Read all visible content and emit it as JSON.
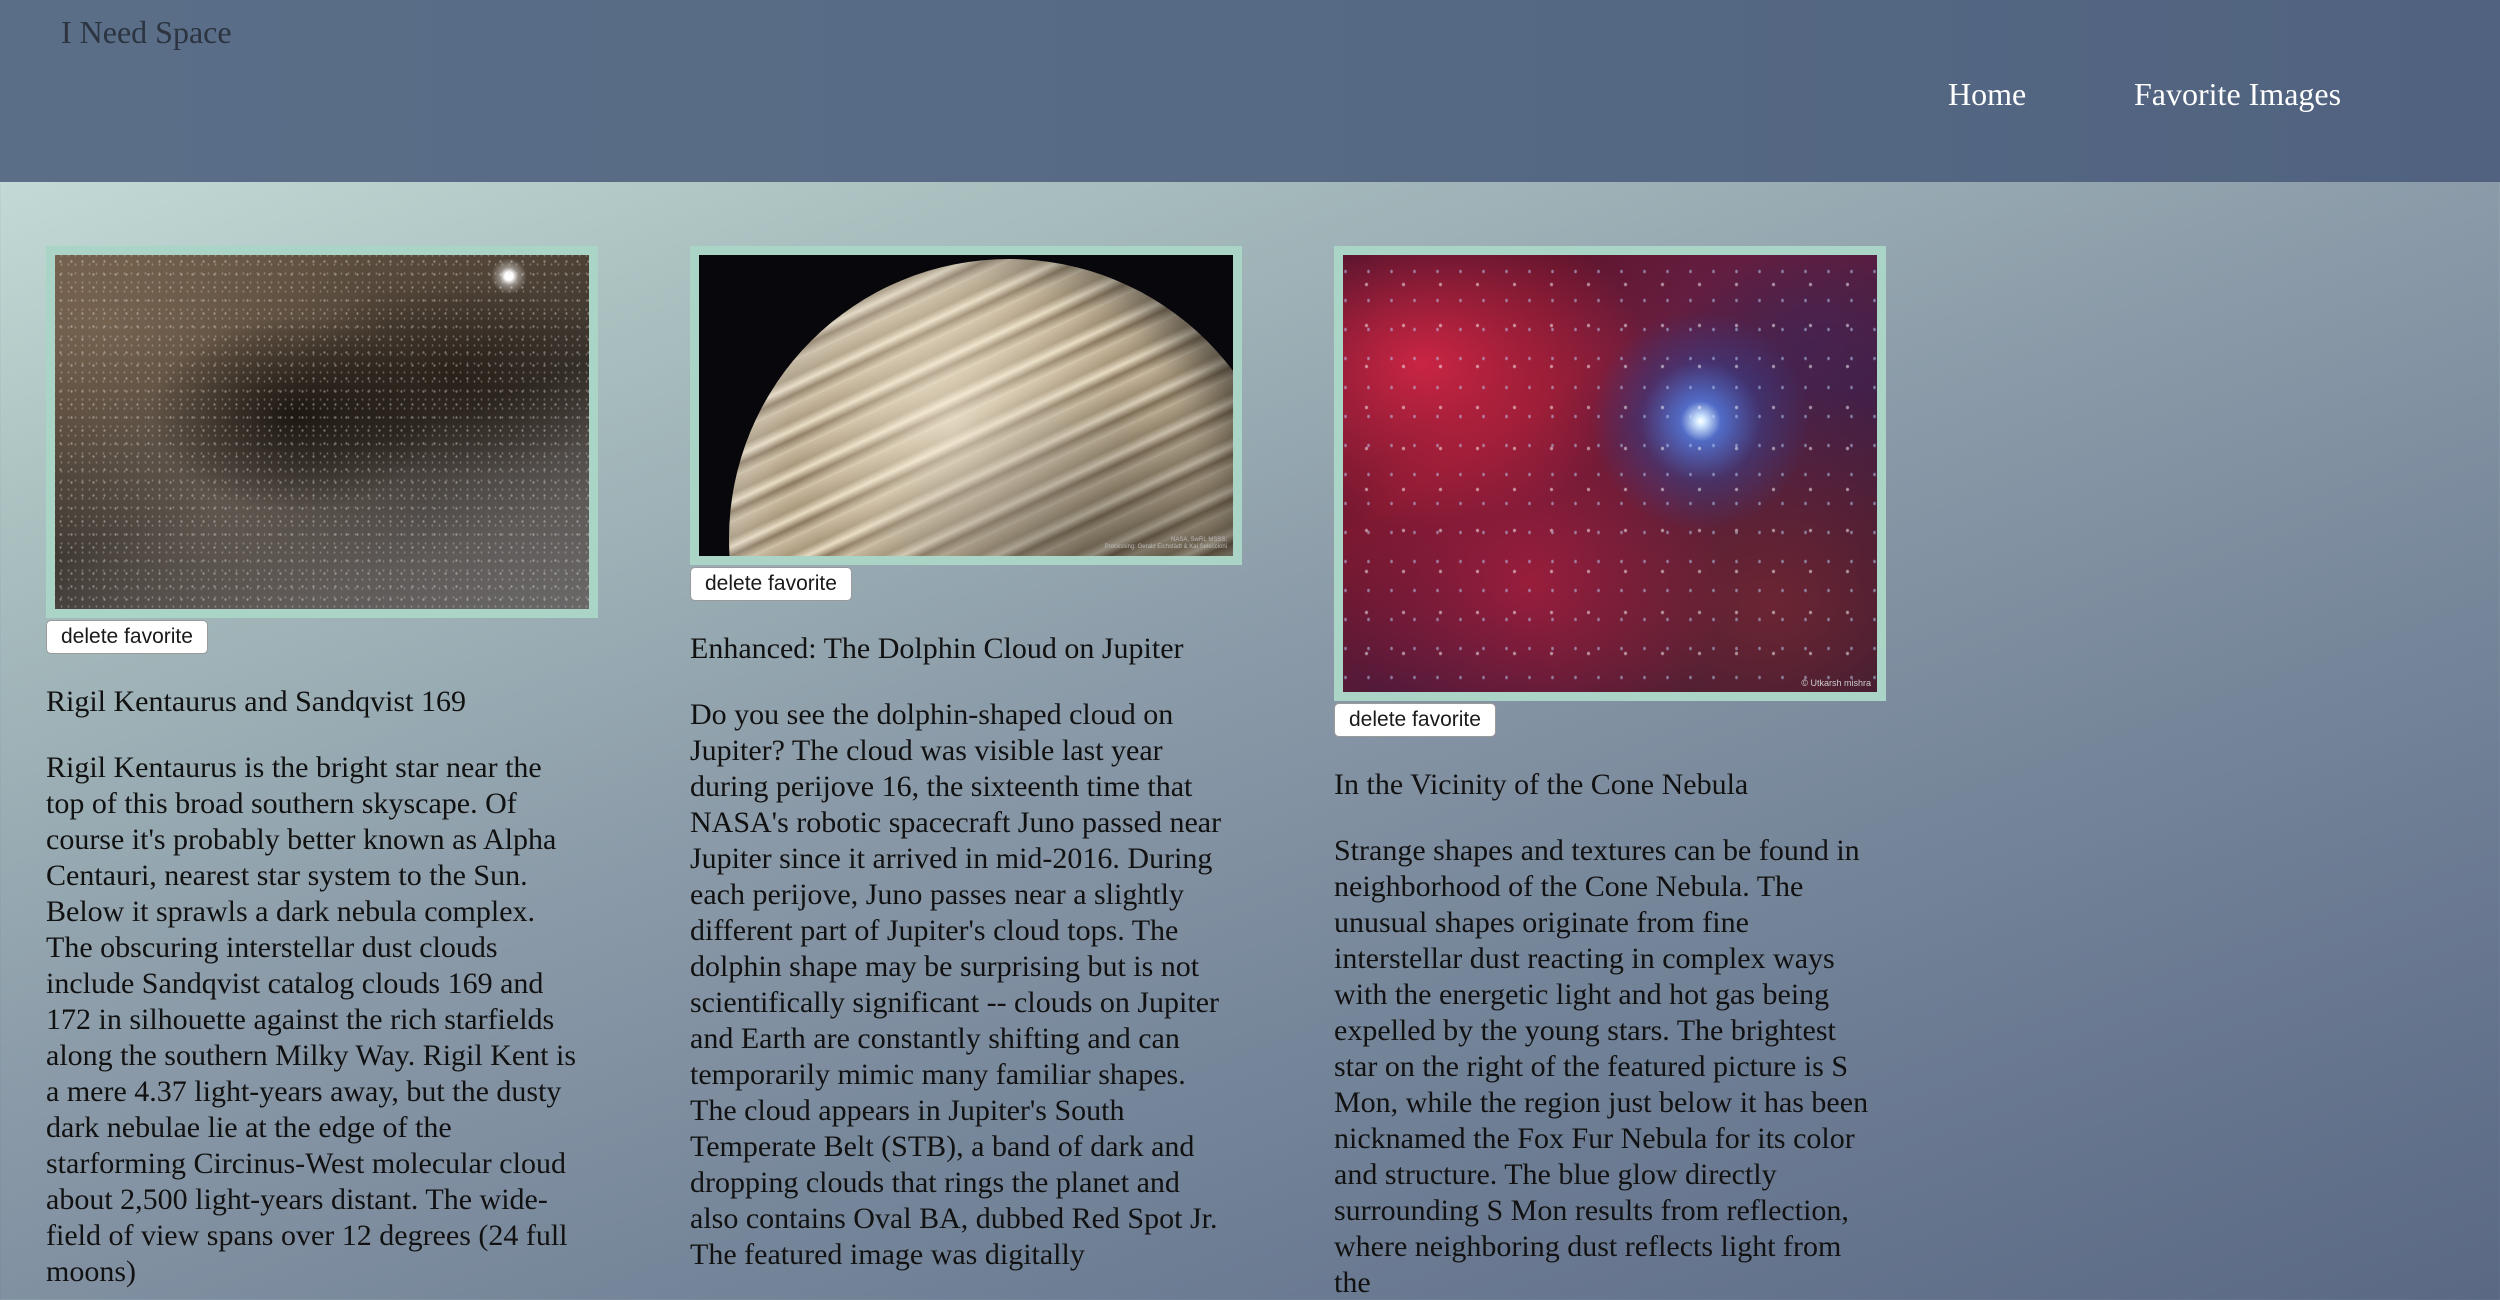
{
  "header": {
    "site_title": "I Need Space",
    "nav": {
      "home": "Home",
      "favorites": "Favorite Images"
    }
  },
  "cards": [
    {
      "image_alt": "Rigil Kentaurus and Sandqvist 169",
      "delete_label": "delete favorite",
      "title": "Rigil Kentaurus and Sandqvist 169",
      "description": "Rigil Kentaurus is the bright star near the top of this broad southern skyscape. Of course it's probably better known as Alpha Centauri, nearest star system to the Sun. Below it sprawls a dark nebula complex. The obscuring interstellar dust clouds include Sandqvist catalog clouds 169 and 172 in silhouette against the rich starfields along the southern Milky Way. Rigil Kent is a mere 4.37 light-years away, but the dusty dark nebulae lie at the edge of the starforming Circinus-West molecular cloud about 2,500 light-years distant. The wide-field of view spans over 12 degrees (24 full moons)"
    },
    {
      "image_alt": "Enhanced: The Dolphin Cloud on Jupiter",
      "image_credit": "NASA, SwRI, MSSS;\nProcessing: Gerald Eichstädt & Kai Seleccioni",
      "delete_label": "delete favorite",
      "title": "Enhanced: The Dolphin Cloud on Jupiter",
      "description": "Do you see the dolphin-shaped cloud on Jupiter? The cloud was visible last year during perijove 16, the sixteenth time that NASA's robotic spacecraft Juno passed near Jupiter since it arrived in mid-2016. During each perijove, Juno passes near a slightly different part of Jupiter's cloud tops. The dolphin shape may be surprising but is not scientifically significant -- clouds on Jupiter and Earth are constantly shifting and can temporarily mimic many familiar shapes. The cloud appears in Jupiter's South Temperate Belt (STB), a band of dark and dropping clouds that rings the planet and also contains Oval BA, dubbed Red Spot Jr. The featured image was digitally"
    },
    {
      "image_alt": "In the Vicinity of the Cone Nebula",
      "image_credit": "© Utkarsh mishra",
      "delete_label": "delete favorite",
      "title": "In the Vicinity of the Cone Nebula",
      "description": "Strange shapes and textures can be found in neighborhood of the Cone Nebula. The unusual shapes originate from fine interstellar dust reacting in complex ways with the energetic light and hot gas being expelled by the young stars. The brightest star on the right of the featured picture is S Mon, while the region just below it has been nicknamed the Fox Fur Nebula for its color and structure. The blue glow directly surrounding S Mon results from reflection, where neighboring dust reflects light from the"
    }
  ]
}
